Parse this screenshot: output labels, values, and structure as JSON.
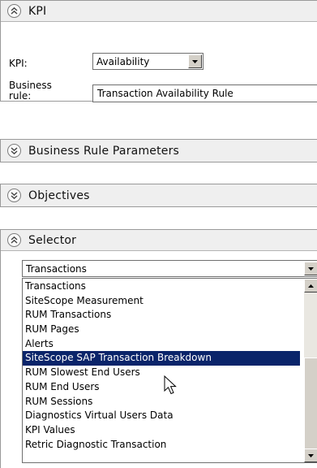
{
  "kpi_panel": {
    "title": "KPI",
    "kpi_label": "KPI:",
    "kpi_value": "Availability",
    "business_rule_label_line1": "Business",
    "business_rule_label_line2": "rule:",
    "business_rule_value": "Transaction Availability Rule"
  },
  "business_rule_parameters_panel": {
    "title": "Business Rule Parameters"
  },
  "objectives_panel": {
    "title": "Objectives"
  },
  "selector_panel": {
    "title": "Selector",
    "selected_value": "Transactions",
    "options": [
      "Transactions",
      "SiteScope Measurement",
      "RUM Transactions",
      "RUM Pages",
      "Alerts",
      "SiteScope SAP Transaction Breakdown",
      "RUM Slowest End Users",
      "RUM End Users",
      "RUM Sessions",
      "Diagnostics Virtual Users Data",
      "KPI Values",
      "Retric Diagnostic Transaction"
    ],
    "highlighted_option": "SiteScope SAP Transaction Breakdown"
  },
  "icons": {
    "expanded_toggle": "double-chevron-up-icon",
    "collapsed_toggle": "double-chevron-down-icon",
    "dropdown_arrow": "triangle-down-icon",
    "scroll_up": "triangle-up-icon",
    "scroll_down": "triangle-down-icon",
    "cursor": "mouse-pointer-icon"
  },
  "colors": {
    "selection_background": "#0a246a",
    "selection_text": "#ffffff",
    "header_background": "#efefef"
  }
}
